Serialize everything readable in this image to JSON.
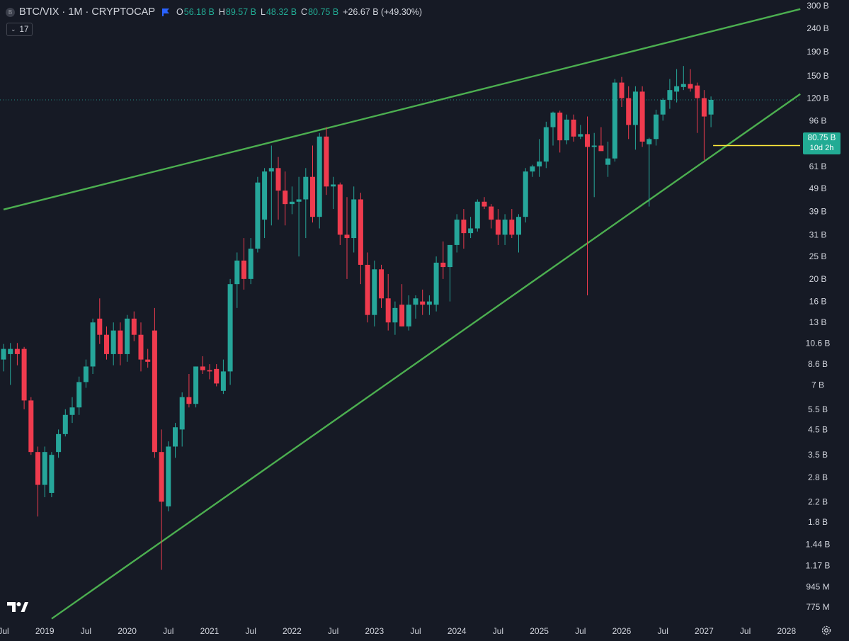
{
  "header": {
    "symbol_icon": "B",
    "title": "BTC/VIX · 1M · CRYPTOCAP",
    "flag_icon": "flag-icon",
    "ohlc": [
      {
        "key": "O",
        "value": "56.18 B"
      },
      {
        "key": "H",
        "value": "89.57 B"
      },
      {
        "key": "L",
        "value": "48.32 B"
      },
      {
        "key": "C",
        "value": "80.75 B"
      }
    ],
    "change": "+26.67 B (+49.30%)"
  },
  "indicator": {
    "label": "17"
  },
  "last_price": {
    "value": "80.75 B",
    "countdown": "10d 2h"
  },
  "colors": {
    "background": "#161a25",
    "up": "#26a69a",
    "down": "#ef3b4e",
    "trendline": "#4caf50",
    "level": "#ffeb3b",
    "text": "#d1d4dc"
  },
  "chart_data": {
    "type": "candlestick",
    "symbol": "BTC/VIX",
    "interval": "1M",
    "y_scale": "log",
    "ylim": [
      0.7,
      300
    ],
    "x_start": "2018-07",
    "x_end": "2028-03",
    "y_ticks": [
      {
        "v": 300,
        "label": "300 B"
      },
      {
        "v": 240,
        "label": "240 B"
      },
      {
        "v": 190,
        "label": "190 B"
      },
      {
        "v": 150,
        "label": "150 B"
      },
      {
        "v": 120,
        "label": "120 B"
      },
      {
        "v": 96,
        "label": "96 B"
      },
      {
        "v": 61,
        "label": "61 B"
      },
      {
        "v": 49,
        "label": "49 B"
      },
      {
        "v": 39,
        "label": "39 B"
      },
      {
        "v": 31,
        "label": "31 B"
      },
      {
        "v": 25,
        "label": "25 B"
      },
      {
        "v": 20,
        "label": "20 B"
      },
      {
        "v": 16,
        "label": "16 B"
      },
      {
        "v": 13,
        "label": "13 B"
      },
      {
        "v": 10.6,
        "label": "10.6 B"
      },
      {
        "v": 8.6,
        "label": "8.6 B"
      },
      {
        "v": 7,
        "label": "7 B"
      },
      {
        "v": 5.5,
        "label": "5.5 B"
      },
      {
        "v": 4.5,
        "label": "4.5 B"
      },
      {
        "v": 3.5,
        "label": "3.5 B"
      },
      {
        "v": 2.8,
        "label": "2.8 B"
      },
      {
        "v": 2.2,
        "label": "2.2 B"
      },
      {
        "v": 1.8,
        "label": "1.8 B"
      },
      {
        "v": 1.44,
        "label": "1.44 B"
      },
      {
        "v": 1.17,
        "label": "1.17 B"
      },
      {
        "v": 0.945,
        "label": "945 M"
      },
      {
        "v": 0.775,
        "label": "775 M"
      }
    ],
    "x_ticks": [
      {
        "date": "2018-07",
        "label": "Jul"
      },
      {
        "date": "2019-01",
        "label": "2019"
      },
      {
        "date": "2019-07",
        "label": "Jul"
      },
      {
        "date": "2020-01",
        "label": "2020"
      },
      {
        "date": "2020-07",
        "label": "Jul"
      },
      {
        "date": "2021-01",
        "label": "2021"
      },
      {
        "date": "2021-07",
        "label": "Jul"
      },
      {
        "date": "2022-01",
        "label": "2022"
      },
      {
        "date": "2022-07",
        "label": "Jul"
      },
      {
        "date": "2023-01",
        "label": "2023"
      },
      {
        "date": "2023-07",
        "label": "Jul"
      },
      {
        "date": "2024-01",
        "label": "2024"
      },
      {
        "date": "2024-07",
        "label": "Jul"
      },
      {
        "date": "2025-01",
        "label": "2025"
      },
      {
        "date": "2025-07",
        "label": "Jul"
      },
      {
        "date": "2026-01",
        "label": "2026"
      },
      {
        "date": "2026-07",
        "label": "Jul"
      },
      {
        "date": "2027-01",
        "label": "2027"
      },
      {
        "date": "2027-07",
        "label": "Jul"
      },
      {
        "date": "2028-01",
        "label": "2028"
      }
    ],
    "candles": [
      {
        "date": "2018-07",
        "o": 9,
        "h": 10.5,
        "l": 8,
        "c": 10
      },
      {
        "date": "2018-08",
        "o": 9.5,
        "h": 10.6,
        "l": 7,
        "c": 10
      },
      {
        "date": "2018-09",
        "o": 10,
        "h": 10.6,
        "l": 8.5,
        "c": 9.5
      },
      {
        "date": "2018-10",
        "o": 10,
        "h": 10.2,
        "l": 5.5,
        "c": 6
      },
      {
        "date": "2018-11",
        "o": 6,
        "h": 6.2,
        "l": 3.5,
        "c": 3.6
      },
      {
        "date": "2018-12",
        "o": 3.6,
        "h": 3.8,
        "l": 1.9,
        "c": 2.6
      },
      {
        "date": "2019-01",
        "o": 2.6,
        "h": 3.8,
        "l": 2.3,
        "c": 3.6
      },
      {
        "date": "2019-02",
        "o": 2.4,
        "h": 3.6,
        "l": 2.3,
        "c": 3.5
      },
      {
        "date": "2019-03",
        "o": 3.6,
        "h": 4.5,
        "l": 3.4,
        "c": 4.3
      },
      {
        "date": "2019-04",
        "o": 4.3,
        "h": 5.5,
        "l": 4.2,
        "c": 5.2
      },
      {
        "date": "2019-05",
        "o": 5.2,
        "h": 6.2,
        "l": 4.8,
        "c": 5.6
      },
      {
        "date": "2019-06",
        "o": 5.6,
        "h": 7.6,
        "l": 5.2,
        "c": 7.2
      },
      {
        "date": "2019-07",
        "o": 7.2,
        "h": 9,
        "l": 6.8,
        "c": 8.4
      },
      {
        "date": "2019-08",
        "o": 8.4,
        "h": 13.5,
        "l": 7.8,
        "c": 13
      },
      {
        "date": "2019-09",
        "o": 13.5,
        "h": 16.5,
        "l": 10.5,
        "c": 11.5
      },
      {
        "date": "2019-10",
        "o": 11.5,
        "h": 12.5,
        "l": 9,
        "c": 9.5
      },
      {
        "date": "2019-11",
        "o": 9.5,
        "h": 13,
        "l": 8.5,
        "c": 12
      },
      {
        "date": "2019-12",
        "o": 12,
        "h": 13,
        "l": 8.5,
        "c": 9.5
      },
      {
        "date": "2020-01",
        "o": 9.5,
        "h": 14,
        "l": 8.8,
        "c": 13.5
      },
      {
        "date": "2020-02",
        "o": 13.5,
        "h": 14.5,
        "l": 10.8,
        "c": 11.5
      },
      {
        "date": "2020-03",
        "o": 11.5,
        "h": 13,
        "l": 8,
        "c": 9
      },
      {
        "date": "2020-04",
        "o": 9,
        "h": 10,
        "l": 8.3,
        "c": 8.8
      },
      {
        "date": "2020-05",
        "o": 12,
        "h": 15,
        "l": 3.4,
        "c": 3.6
      },
      {
        "date": "2020-06",
        "o": 3.6,
        "h": 4.5,
        "l": 1.12,
        "c": 2.2
      },
      {
        "date": "2020-07",
        "o": 2.1,
        "h": 4,
        "l": 2,
        "c": 3.8
      },
      {
        "date": "2020-08",
        "o": 3.8,
        "h": 4.8,
        "l": 3.4,
        "c": 4.6
      },
      {
        "date": "2020-09",
        "o": 4.5,
        "h": 6.5,
        "l": 3.8,
        "c": 6.2
      },
      {
        "date": "2020-10",
        "o": 6.2,
        "h": 7.8,
        "l": 5.6,
        "c": 5.8
      },
      {
        "date": "2020-11",
        "o": 5.8,
        "h": 8.4,
        "l": 5.6,
        "c": 8.4
      },
      {
        "date": "2020-12",
        "o": 8.4,
        "h": 9.3,
        "l": 7.8,
        "c": 8.1
      },
      {
        "date": "2021-01",
        "o": 8.1,
        "h": 8.6,
        "l": 7.4,
        "c": 8
      },
      {
        "date": "2021-02",
        "o": 8.2,
        "h": 8.6,
        "l": 6.9,
        "c": 7.1
      },
      {
        "date": "2021-03",
        "o": 6.6,
        "h": 9,
        "l": 6.4,
        "c": 8
      },
      {
        "date": "2021-04",
        "o": 8,
        "h": 20,
        "l": 7,
        "c": 19
      },
      {
        "date": "2021-05",
        "o": 19,
        "h": 26,
        "l": 15,
        "c": 24
      },
      {
        "date": "2021-06",
        "o": 24,
        "h": 30,
        "l": 18,
        "c": 20
      },
      {
        "date": "2021-07",
        "o": 20,
        "h": 30,
        "l": 19,
        "c": 27
      },
      {
        "date": "2021-08",
        "o": 27,
        "h": 55,
        "l": 26,
        "c": 52
      },
      {
        "date": "2021-09",
        "o": 36,
        "h": 60,
        "l": 30,
        "c": 58
      },
      {
        "date": "2021-10",
        "o": 58,
        "h": 75,
        "l": 34,
        "c": 60
      },
      {
        "date": "2021-11",
        "o": 60,
        "h": 67,
        "l": 36,
        "c": 48
      },
      {
        "date": "2021-12",
        "o": 48,
        "h": 58,
        "l": 34,
        "c": 42
      },
      {
        "date": "2022-01",
        "o": 42,
        "h": 50,
        "l": 38,
        "c": 43
      },
      {
        "date": "2022-02",
        "o": 43,
        "h": 55,
        "l": 25,
        "c": 44
      },
      {
        "date": "2022-03",
        "o": 44,
        "h": 60,
        "l": 30,
        "c": 55
      },
      {
        "date": "2022-04",
        "o": 55,
        "h": 75,
        "l": 35,
        "c": 37
      },
      {
        "date": "2022-05",
        "o": 37,
        "h": 85,
        "l": 33,
        "c": 82
      },
      {
        "date": "2022-06",
        "o": 82,
        "h": 90,
        "l": 46,
        "c": 50
      },
      {
        "date": "2022-07",
        "o": 50,
        "h": 55,
        "l": 40,
        "c": 51
      },
      {
        "date": "2022-08",
        "o": 51,
        "h": 52,
        "l": 28,
        "c": 31
      },
      {
        "date": "2022-09",
        "o": 31,
        "h": 45,
        "l": 20,
        "c": 30
      },
      {
        "date": "2022-10",
        "o": 30,
        "h": 50,
        "l": 26,
        "c": 44
      },
      {
        "date": "2022-11",
        "o": 44,
        "h": 47,
        "l": 19,
        "c": 23
      },
      {
        "date": "2022-12",
        "o": 23,
        "h": 26,
        "l": 13,
        "c": 14
      },
      {
        "date": "2023-01",
        "o": 14,
        "h": 24,
        "l": 12.5,
        "c": 22
      },
      {
        "date": "2023-02",
        "o": 22,
        "h": 23,
        "l": 15,
        "c": 16.5
      },
      {
        "date": "2023-03",
        "o": 16.5,
        "h": 21,
        "l": 12,
        "c": 13
      },
      {
        "date": "2023-04",
        "o": 13,
        "h": 16,
        "l": 11.5,
        "c": 15
      },
      {
        "date": "2023-05",
        "o": 15.5,
        "h": 19,
        "l": 12.5,
        "c": 12.5
      },
      {
        "date": "2023-06",
        "o": 12.5,
        "h": 17,
        "l": 12,
        "c": 15.5
      },
      {
        "date": "2023-07",
        "o": 15.5,
        "h": 17,
        "l": 13.5,
        "c": 16.5
      },
      {
        "date": "2023-08",
        "o": 16,
        "h": 18,
        "l": 14,
        "c": 15.5
      },
      {
        "date": "2023-09",
        "o": 15.5,
        "h": 17,
        "l": 14,
        "c": 16
      },
      {
        "date": "2023-10",
        "o": 15.5,
        "h": 25,
        "l": 14.5,
        "c": 23.5
      },
      {
        "date": "2023-11",
        "o": 23.5,
        "h": 29,
        "l": 20,
        "c": 22.5
      },
      {
        "date": "2023-12",
        "o": 22.5,
        "h": 28,
        "l": 16,
        "c": 28
      },
      {
        "date": "2024-01",
        "o": 28,
        "h": 38,
        "l": 26,
        "c": 36
      },
      {
        "date": "2024-02",
        "o": 36,
        "h": 40,
        "l": 27,
        "c": 31.5
      },
      {
        "date": "2024-03",
        "o": 31.5,
        "h": 37,
        "l": 30,
        "c": 33
      },
      {
        "date": "2024-04",
        "o": 33,
        "h": 44,
        "l": 32,
        "c": 43
      },
      {
        "date": "2024-05",
        "o": 43,
        "h": 45,
        "l": 40,
        "c": 41
      },
      {
        "date": "2024-06",
        "o": 41,
        "h": 42,
        "l": 33,
        "c": 36
      },
      {
        "date": "2024-07",
        "o": 36,
        "h": 40,
        "l": 28,
        "c": 31
      },
      {
        "date": "2024-08",
        "o": 31,
        "h": 38,
        "l": 28,
        "c": 36
      },
      {
        "date": "2024-09",
        "o": 36,
        "h": 40,
        "l": 30,
        "c": 31
      },
      {
        "date": "2024-10",
        "o": 31,
        "h": 38,
        "l": 26,
        "c": 37
      },
      {
        "date": "2024-11",
        "o": 37,
        "h": 60,
        "l": 35,
        "c": 58
      },
      {
        "date": "2024-12",
        "o": 58,
        "h": 62,
        "l": 55,
        "c": 61
      },
      {
        "date": "2025-01",
        "o": 61,
        "h": 80,
        "l": 55,
        "c": 64
      },
      {
        "date": "2025-02",
        "o": 64,
        "h": 95,
        "l": 60,
        "c": 90
      },
      {
        "date": "2025-03",
        "o": 90,
        "h": 105,
        "l": 75,
        "c": 104
      },
      {
        "date": "2025-04",
        "o": 104,
        "h": 106,
        "l": 70,
        "c": 79
      },
      {
        "date": "2025-05",
        "o": 79,
        "h": 102,
        "l": 76,
        "c": 97
      },
      {
        "date": "2025-06",
        "o": 97,
        "h": 102,
        "l": 78,
        "c": 82
      },
      {
        "date": "2025-07",
        "o": 82,
        "h": 92,
        "l": 80,
        "c": 84
      },
      {
        "date": "2025-08",
        "o": 84,
        "h": 100,
        "l": 17,
        "c": 74
      },
      {
        "date": "2025-09",
        "o": 74,
        "h": 85,
        "l": 45,
        "c": 75
      },
      {
        "date": "2025-10",
        "o": 75,
        "h": 90,
        "l": 72,
        "c": 71
      },
      {
        "date": "2025-11",
        "o": 62,
        "h": 78,
        "l": 55,
        "c": 66
      },
      {
        "date": "2025-12",
        "o": 66,
        "h": 145,
        "l": 64,
        "c": 140
      },
      {
        "date": "2026-01",
        "o": 140,
        "h": 148,
        "l": 110,
        "c": 120
      },
      {
        "date": "2026-02",
        "o": 120,
        "h": 135,
        "l": 80,
        "c": 92
      },
      {
        "date": "2026-03",
        "o": 92,
        "h": 135,
        "l": 72,
        "c": 128
      },
      {
        "date": "2026-04",
        "o": 128,
        "h": 135,
        "l": 74,
        "c": 78
      },
      {
        "date": "2026-05",
        "o": 76,
        "h": 81,
        "l": 41,
        "c": 80
      },
      {
        "date": "2026-06",
        "o": 80,
        "h": 107,
        "l": 75,
        "c": 102
      },
      {
        "date": "2026-07",
        "o": 102,
        "h": 120,
        "l": 96,
        "c": 118
      },
      {
        "date": "2026-08",
        "o": 118,
        "h": 145,
        "l": 108,
        "c": 130
      },
      {
        "date": "2026-09",
        "o": 128,
        "h": 160,
        "l": 115,
        "c": 135
      },
      {
        "date": "2026-10",
        "o": 134,
        "h": 165,
        "l": 130,
        "c": 138
      },
      {
        "date": "2026-11",
        "o": 138,
        "h": 160,
        "l": 128,
        "c": 132
      },
      {
        "date": "2026-12",
        "o": 136,
        "h": 140,
        "l": 85,
        "c": 120
      },
      {
        "date": "2027-01",
        "o": 120,
        "h": 130,
        "l": 65,
        "c": 100
      },
      {
        "date": "2027-02",
        "o": 102,
        "h": 122,
        "l": 90,
        "c": 118
      }
    ]
  }
}
